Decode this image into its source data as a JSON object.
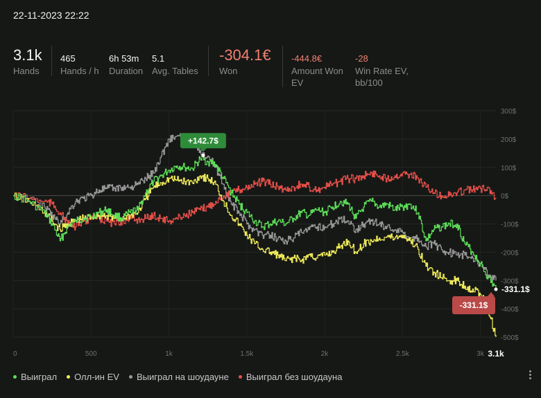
{
  "header": {
    "datetime": "22-11-2023 22:22"
  },
  "stats": {
    "hands": {
      "value": "3.1k",
      "label": "Hands"
    },
    "hands_per_hour": {
      "value": "465",
      "label": "Hands / h"
    },
    "duration": {
      "value": "6h 53m",
      "label": "Duration"
    },
    "avg_tables": {
      "value": "5.1",
      "label": "Avg. Tables"
    },
    "won": {
      "value": "-304.1€",
      "label": "Won"
    },
    "amount_won_ev": {
      "value": "-444.8€",
      "label_line1": "Amount Won",
      "label_line2": "EV"
    },
    "win_rate_ev": {
      "value": "-28",
      "label_line1": "Win Rate EV,",
      "label_line2": "bb/100"
    }
  },
  "colors": {
    "green": "#5ee05a",
    "yellow": "#f2ee5a",
    "gray": "#9a9a9a",
    "red": "#e8504a",
    "badge_green": "#2e8b3a",
    "badge_red": "#b94a48"
  },
  "chart_data": {
    "type": "line",
    "x_unit": "hands",
    "xlim": [
      0,
      3100
    ],
    "ylim": [
      -500,
      300
    ],
    "x_ticks": [
      {
        "value": 0,
        "label": "0"
      },
      {
        "value": 500,
        "label": "500"
      },
      {
        "value": 1000,
        "label": "1k"
      },
      {
        "value": 1500,
        "label": "1.5k"
      },
      {
        "value": 2000,
        "label": "2k"
      },
      {
        "value": 2500,
        "label": "2.5k"
      },
      {
        "value": 3000,
        "label": "3k"
      }
    ],
    "x_end_label": "3.1k",
    "y_ticks": [
      {
        "value": 300,
        "label": "300$"
      },
      {
        "value": 200,
        "label": "200$"
      },
      {
        "value": 100,
        "label": "100$"
      },
      {
        "value": 0,
        "label": "0$"
      },
      {
        "value": -100,
        "label": "-100$"
      },
      {
        "value": -200,
        "label": "-200$"
      },
      {
        "value": -300,
        "label": "-300$"
      },
      {
        "value": -400,
        "label": "-400$"
      },
      {
        "value": -500,
        "label": "-500$"
      }
    ],
    "series": [
      {
        "name": "Выиграл",
        "color": "#5ee05a",
        "x": [
          0,
          100,
          200,
          250,
          300,
          350,
          400,
          450,
          500,
          550,
          600,
          650,
          700,
          750,
          800,
          850,
          900,
          950,
          1000,
          1050,
          1100,
          1150,
          1200,
          1250,
          1300,
          1350,
          1400,
          1450,
          1500,
          1550,
          1600,
          1650,
          1700,
          1750,
          1800,
          1850,
          1900,
          1950,
          2000,
          2050,
          2100,
          2150,
          2200,
          2250,
          2300,
          2350,
          2400,
          2450,
          2500,
          2550,
          2600,
          2650,
          2700,
          2750,
          2800,
          2850,
          2900,
          2950,
          3000,
          3050,
          3100
        ],
        "y": [
          0,
          -20,
          -60,
          -100,
          -160,
          -110,
          -90,
          -80,
          -75,
          -60,
          -50,
          -70,
          -80,
          -60,
          -50,
          10,
          50,
          70,
          90,
          105,
          100,
          95,
          130,
          120,
          110,
          60,
          10,
          -30,
          -60,
          -90,
          -110,
          -100,
          -90,
          -100,
          -80,
          -60,
          -70,
          -50,
          -60,
          -40,
          -20,
          -30,
          -80,
          -40,
          -20,
          -40,
          -30,
          -50,
          -40,
          -30,
          -60,
          -160,
          -120,
          -110,
          -100,
          -100,
          -170,
          -200,
          -240,
          -290,
          -331.1
        ]
      },
      {
        "name": "Олл-ин EV",
        "color": "#f2ee5a",
        "x": [
          0,
          100,
          200,
          250,
          300,
          350,
          400,
          450,
          500,
          550,
          600,
          650,
          700,
          750,
          800,
          850,
          900,
          950,
          1000,
          1050,
          1100,
          1150,
          1200,
          1250,
          1300,
          1350,
          1400,
          1450,
          1500,
          1550,
          1600,
          1650,
          1700,
          1750,
          1800,
          1850,
          1900,
          1950,
          2000,
          2050,
          2100,
          2150,
          2200,
          2250,
          2300,
          2350,
          2400,
          2450,
          2500,
          2550,
          2600,
          2650,
          2700,
          2750,
          2800,
          2850,
          2900,
          2950,
          3000,
          3050,
          3100
        ],
        "y": [
          0,
          -20,
          -60,
          -90,
          -120,
          -100,
          -90,
          -80,
          -75,
          -70,
          -70,
          -80,
          -80,
          -70,
          -60,
          -10,
          30,
          45,
          60,
          55,
          50,
          45,
          70,
          60,
          40,
          -20,
          -70,
          -100,
          -140,
          -170,
          -190,
          -200,
          -210,
          -230,
          -220,
          -230,
          -210,
          -220,
          -210,
          -200,
          -180,
          -160,
          -200,
          -170,
          -160,
          -150,
          -145,
          -150,
          -140,
          -160,
          -190,
          -250,
          -270,
          -290,
          -300,
          -300,
          -320,
          -330,
          -350,
          -400,
          -500
        ]
      },
      {
        "name": "Выиграл на шоудауне",
        "color": "#9a9a9a",
        "x": [
          0,
          100,
          200,
          250,
          300,
          350,
          400,
          450,
          500,
          550,
          600,
          650,
          700,
          750,
          800,
          850,
          900,
          950,
          1000,
          1050,
          1100,
          1150,
          1200,
          1250,
          1300,
          1350,
          1400,
          1450,
          1500,
          1550,
          1600,
          1650,
          1700,
          1750,
          1800,
          1850,
          1900,
          1950,
          2000,
          2050,
          2100,
          2150,
          2200,
          2250,
          2300,
          2350,
          2400,
          2450,
          2500,
          2550,
          2600,
          2650,
          2700,
          2750,
          2800,
          2850,
          2900,
          2950,
          3000,
          3050,
          3100
        ],
        "y": [
          0,
          -10,
          -40,
          -70,
          -100,
          -60,
          -20,
          -10,
          0,
          20,
          25,
          25,
          30,
          30,
          40,
          60,
          80,
          140,
          200,
          210,
          200,
          190,
          160,
          140,
          100,
          40,
          -30,
          -60,
          -100,
          -120,
          -140,
          -140,
          -150,
          -160,
          -150,
          -130,
          -120,
          -110,
          -110,
          -100,
          -80,
          -90,
          -120,
          -100,
          -90,
          -100,
          -110,
          -120,
          -130,
          -150,
          -150,
          -180,
          -170,
          -190,
          -200,
          -210,
          -210,
          -220,
          -240,
          -280,
          -300
        ]
      },
      {
        "name": "Выиграл без шоудауна",
        "color": "#e8504a",
        "x": [
          0,
          100,
          200,
          250,
          300,
          350,
          400,
          450,
          500,
          550,
          600,
          650,
          700,
          750,
          800,
          850,
          900,
          950,
          1000,
          1050,
          1100,
          1150,
          1200,
          1250,
          1300,
          1350,
          1400,
          1450,
          1500,
          1550,
          1600,
          1650,
          1700,
          1750,
          1800,
          1850,
          1900,
          1950,
          2000,
          2050,
          2100,
          2150,
          2200,
          2250,
          2300,
          2350,
          2400,
          2450,
          2500,
          2550,
          2600,
          2650,
          2700,
          2750,
          2800,
          2850,
          2900,
          2950,
          3000,
          3050,
          3100
        ],
        "y": [
          0,
          -10,
          -20,
          -30,
          -60,
          -100,
          -110,
          -90,
          -80,
          -80,
          -90,
          -100,
          -90,
          -80,
          -85,
          -80,
          -70,
          -80,
          -90,
          -80,
          -70,
          -60,
          -50,
          -40,
          -20,
          0,
          10,
          20,
          30,
          40,
          50,
          40,
          30,
          20,
          30,
          40,
          30,
          20,
          30,
          40,
          50,
          60,
          60,
          70,
          80,
          70,
          60,
          70,
          80,
          75,
          60,
          30,
          10,
          0,
          0,
          10,
          20,
          20,
          25,
          30,
          -10
        ]
      }
    ],
    "annotations": [
      {
        "label": "+142.7$",
        "x": 1220,
        "y": 142.7,
        "style": "green-badge"
      },
      {
        "label": "-331.1$",
        "x": 3100,
        "y": -331.1,
        "style": "red-badge"
      },
      {
        "label": "-331.1$",
        "x": 3100,
        "y": -331.1,
        "style": "edge-label"
      }
    ]
  },
  "legend": [
    {
      "name": "Выиграл",
      "color": "#5ee05a"
    },
    {
      "name": "Олл-ин EV",
      "color": "#f2ee5a"
    },
    {
      "name": "Выиграл на шоудауне",
      "color": "#9a9a9a"
    },
    {
      "name": "Выиграл без шоудауна",
      "color": "#e8504a"
    }
  ]
}
